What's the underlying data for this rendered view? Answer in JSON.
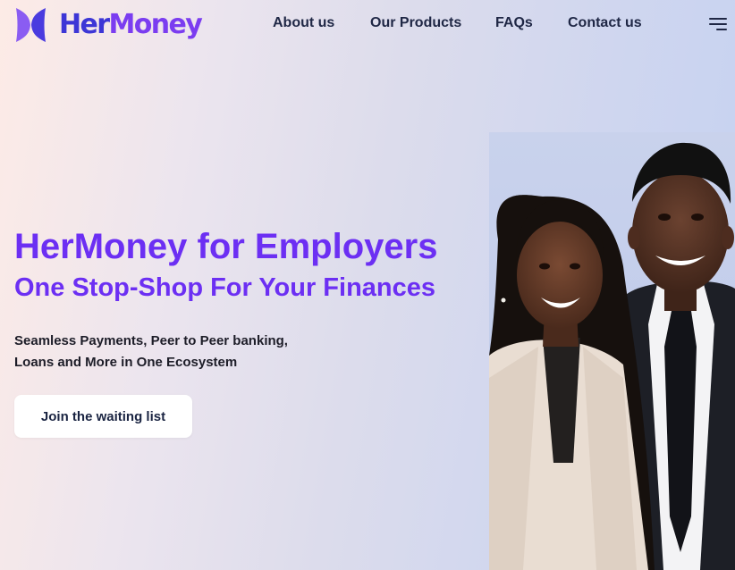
{
  "brand": {
    "name_part1": "Her",
    "name_part2": "Money",
    "logo_icon": "butterfly-logo-icon",
    "colors": {
      "primary": "#6c2ff3",
      "logo_dark": "#3d36d6",
      "logo_light": "#7b3df0"
    }
  },
  "nav": {
    "items": [
      {
        "label": "About us"
      },
      {
        "label": "Our Products"
      },
      {
        "label": "FAQs"
      },
      {
        "label": "Contact us"
      }
    ],
    "menu_icon": "hamburger-menu-icon"
  },
  "hero": {
    "title": "HerMoney for Employers",
    "subtitle": "One Stop-Shop For Your Finances",
    "description_line1": "Seamless Payments, Peer to Peer banking,",
    "description_line2": "Loans and More in One Ecosystem",
    "cta_label": "Join the waiting list",
    "image": "smiling-professional-woman-and-man-photo"
  }
}
